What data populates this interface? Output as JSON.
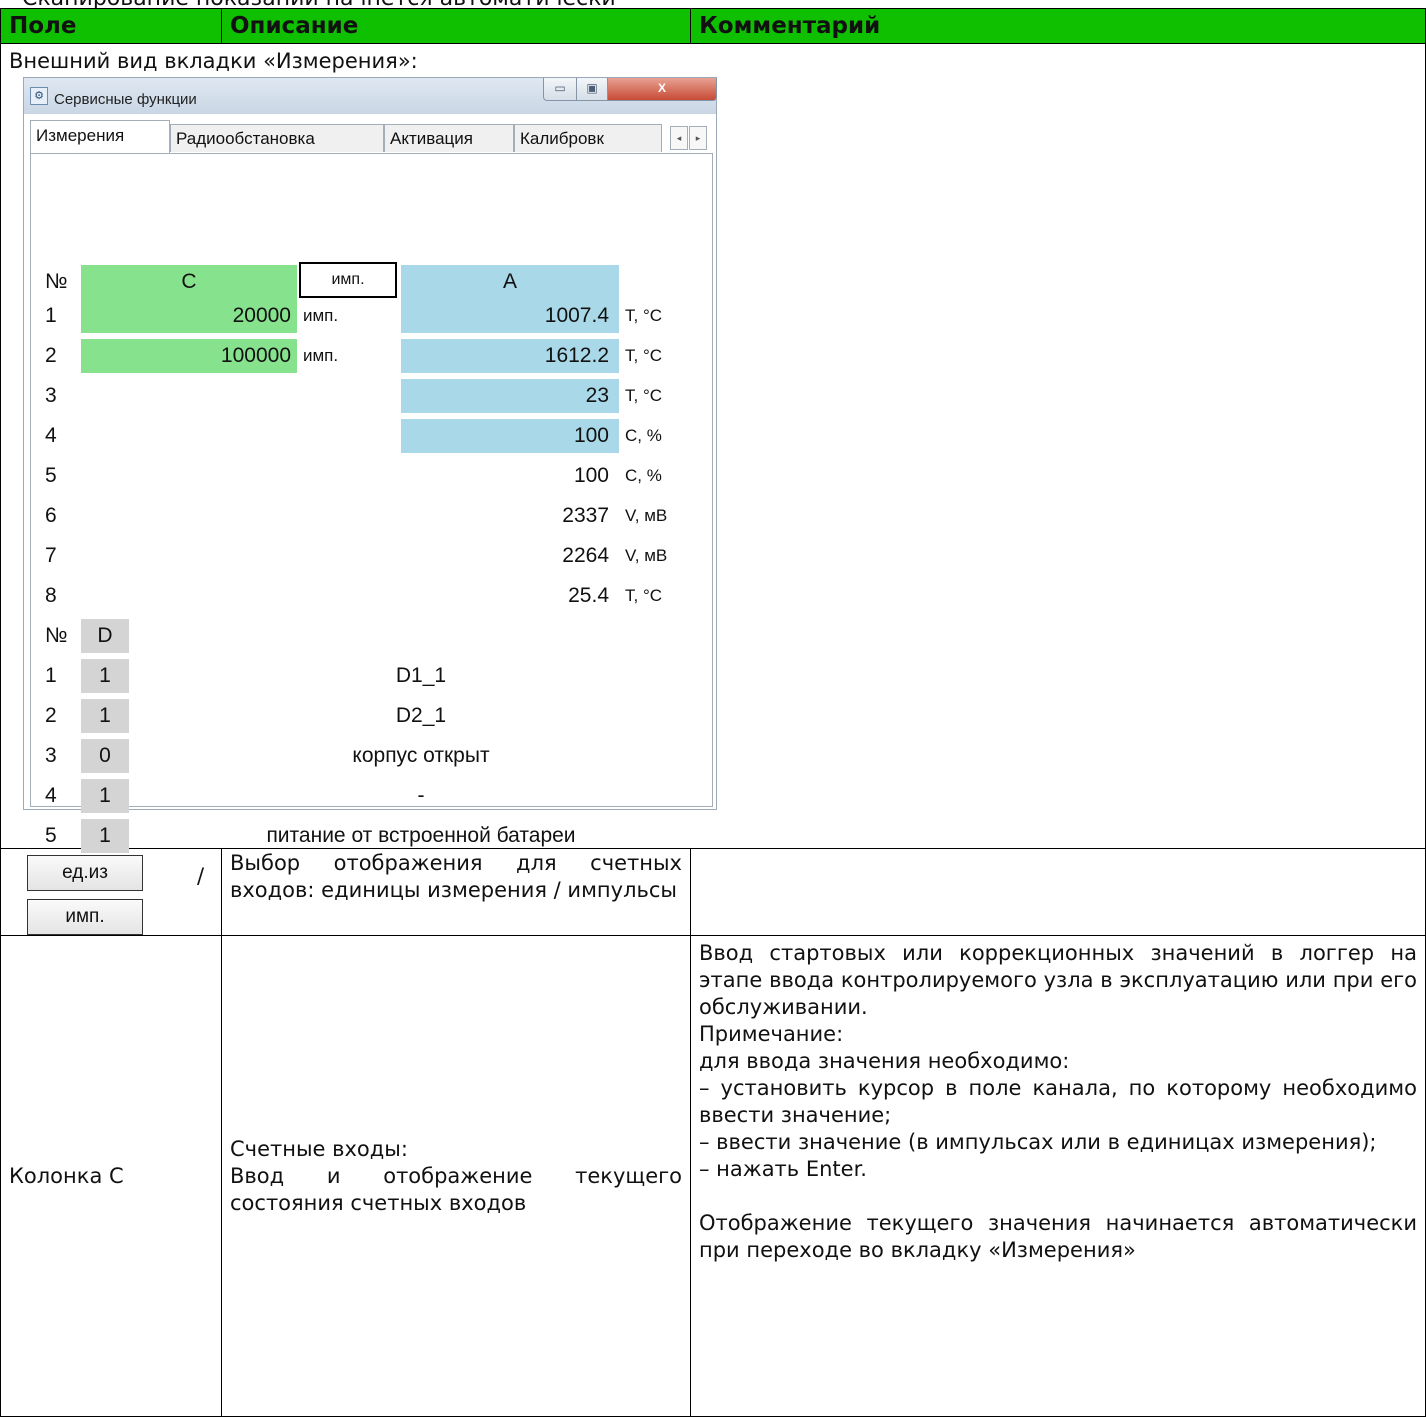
{
  "heading_cut": "Сканирование показаний начнется автоматически",
  "table": {
    "headers": [
      "Поле",
      "Описание",
      "Комментарий"
    ],
    "intro": "Внешний вид вкладки «Измерения»:",
    "rows": [
      {
        "buttons": [
          "ед.из",
          "имп."
        ],
        "separator": "/",
        "description": "Выбор отображения для счетных входов: единицы измерения / импульсы",
        "comment": ""
      },
      {
        "field": "Колонка С",
        "description_lines": [
          "Счетные входы:",
          "Ввод и отображение текущего состояния счетных входов"
        ],
        "comment_lines": [
          "Ввод стартовых или коррекционных значений в логгер на этапе ввода контролируемого узла в эксплуатацию или при его обслуживании.",
          "Примечание:",
          "для ввода значения необходимо:",
          "– установить курсор в поле канала, по которому необходимо ввести значение;",
          "– ввести значение (в импульсах или в единицах измерения);",
          "– нажать Enter.",
          "",
          "Отображение текущего значения начинается автоматически при переходе во вкладку «Измерения»"
        ]
      }
    ]
  },
  "window": {
    "title": "Сервисные функции",
    "controls": {
      "minimize": "▭",
      "maximize": "▣",
      "close": "X"
    },
    "tabs": [
      "Измерения",
      "Радиообстановка",
      "Активация",
      "Калибровк"
    ],
    "tab_scroll": [
      "◂",
      "▸"
    ],
    "headers": {
      "num": "№",
      "c": "C",
      "imp_button": "имп.",
      "a": "A"
    },
    "measurements": [
      {
        "n": "1",
        "c": "20000",
        "c_unit": "имп.",
        "a": "1007.4",
        "a_unit": "T, °C"
      },
      {
        "n": "2",
        "c": "100000",
        "c_unit": "имп.",
        "a": "1612.2",
        "a_unit": "T, °C"
      },
      {
        "n": "3",
        "a": "23",
        "a_unit": "T, °C"
      },
      {
        "n": "4",
        "a": "100",
        "a_unit": "C, %"
      },
      {
        "n": "5",
        "a": "100",
        "a_unit": "C, %"
      },
      {
        "n": "6",
        "a": "2337",
        "a_unit": "V, мВ"
      },
      {
        "n": "7",
        "a": "2264",
        "a_unit": "V, мВ"
      },
      {
        "n": "8",
        "a": "25.4",
        "a_unit": "T, °C"
      }
    ],
    "discrete_headers": {
      "num": "№",
      "d": "D"
    },
    "discrete": [
      {
        "n": "1",
        "d": "1",
        "label": "D1_1"
      },
      {
        "n": "2",
        "d": "1",
        "label": "D2_1"
      },
      {
        "n": "3",
        "d": "0",
        "label": "корпус открыт"
      },
      {
        "n": "4",
        "d": "1",
        "label": "-"
      },
      {
        "n": "5",
        "d": "1",
        "label": "питание от встроенной батареи"
      }
    ]
  }
}
